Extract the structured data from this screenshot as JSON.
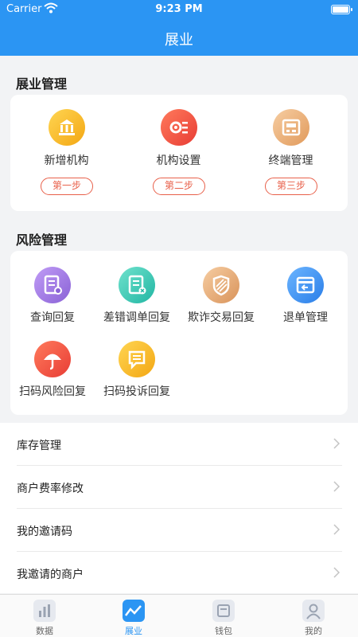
{
  "status": {
    "carrier": "Carrier",
    "time": "9:23 PM"
  },
  "nav": {
    "title": "展业"
  },
  "zhanye": {
    "title": "展业管理",
    "items": [
      {
        "label": "新增机构",
        "step": "第一步",
        "icon": "bank-icon",
        "color": "#f7b51c"
      },
      {
        "label": "机构设置",
        "step": "第二步",
        "icon": "gear-settings-icon",
        "color": "#ef5242"
      },
      {
        "label": "终端管理",
        "step": "第三步",
        "icon": "pos-terminal-icon",
        "color": "#eeb27a"
      }
    ]
  },
  "fengxian": {
    "title": "风险管理",
    "items": [
      {
        "label": "查询回复",
        "icon": "query-doc-icon",
        "color": "#a27ce0"
      },
      {
        "label": "差错调单回复",
        "icon": "error-doc-icon",
        "color": "#3ccbb8"
      },
      {
        "label": "欺诈交易回复",
        "icon": "shield-icon",
        "color": "#e7a56e"
      },
      {
        "label": "退单管理",
        "icon": "refund-icon",
        "color": "#3b8ff0"
      },
      {
        "label": "扫码风险回复",
        "icon": "umbrella-icon",
        "color": "#ef5242"
      },
      {
        "label": "扫码投诉回复",
        "icon": "message-icon",
        "color": "#f7c02a"
      }
    ]
  },
  "list": [
    {
      "label": "库存管理"
    },
    {
      "label": "商户费率修改"
    },
    {
      "label": "我的邀请码"
    },
    {
      "label": "我邀请的商户"
    }
  ],
  "tabs": [
    {
      "label": "数据",
      "icon": "bar-chart-icon",
      "active": false
    },
    {
      "label": "展业",
      "icon": "trend-icon",
      "active": true
    },
    {
      "label": "钱包",
      "icon": "wallet-icon",
      "active": false
    },
    {
      "label": "我的",
      "icon": "user-icon",
      "active": false
    }
  ]
}
